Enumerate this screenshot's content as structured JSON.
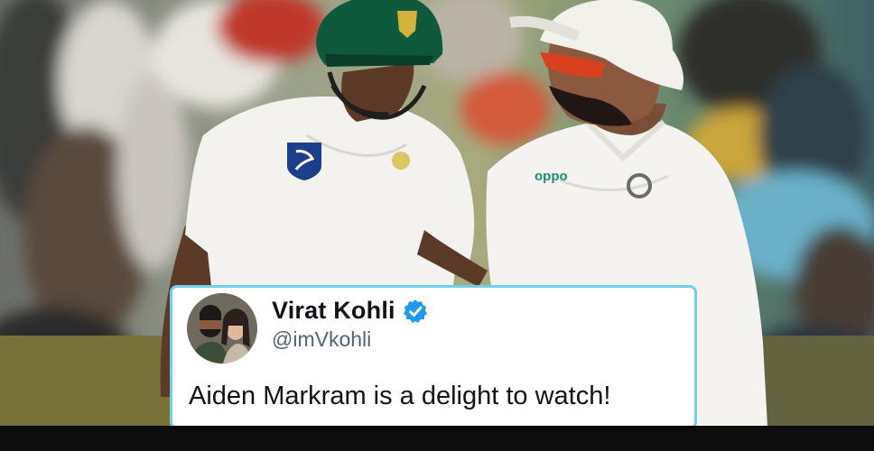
{
  "tweet": {
    "display_name": "Virat Kohli",
    "handle": "@imVkohli",
    "text": "Aiden Markram is a delight to watch!",
    "verified": true
  },
  "icons": {
    "verified": "verified-badge-icon",
    "avatar": "profile-avatar",
    "sponsor_logo": "oppo-logo",
    "crest": "protea-crest-icon"
  },
  "logo_text": {
    "oppo": "oppo"
  },
  "colors": {
    "card_border": "#6fd0e6",
    "verified_blue": "#1d9bf0",
    "sa_green": "#0f5a3c",
    "sa_gold": "#d4b23a"
  }
}
